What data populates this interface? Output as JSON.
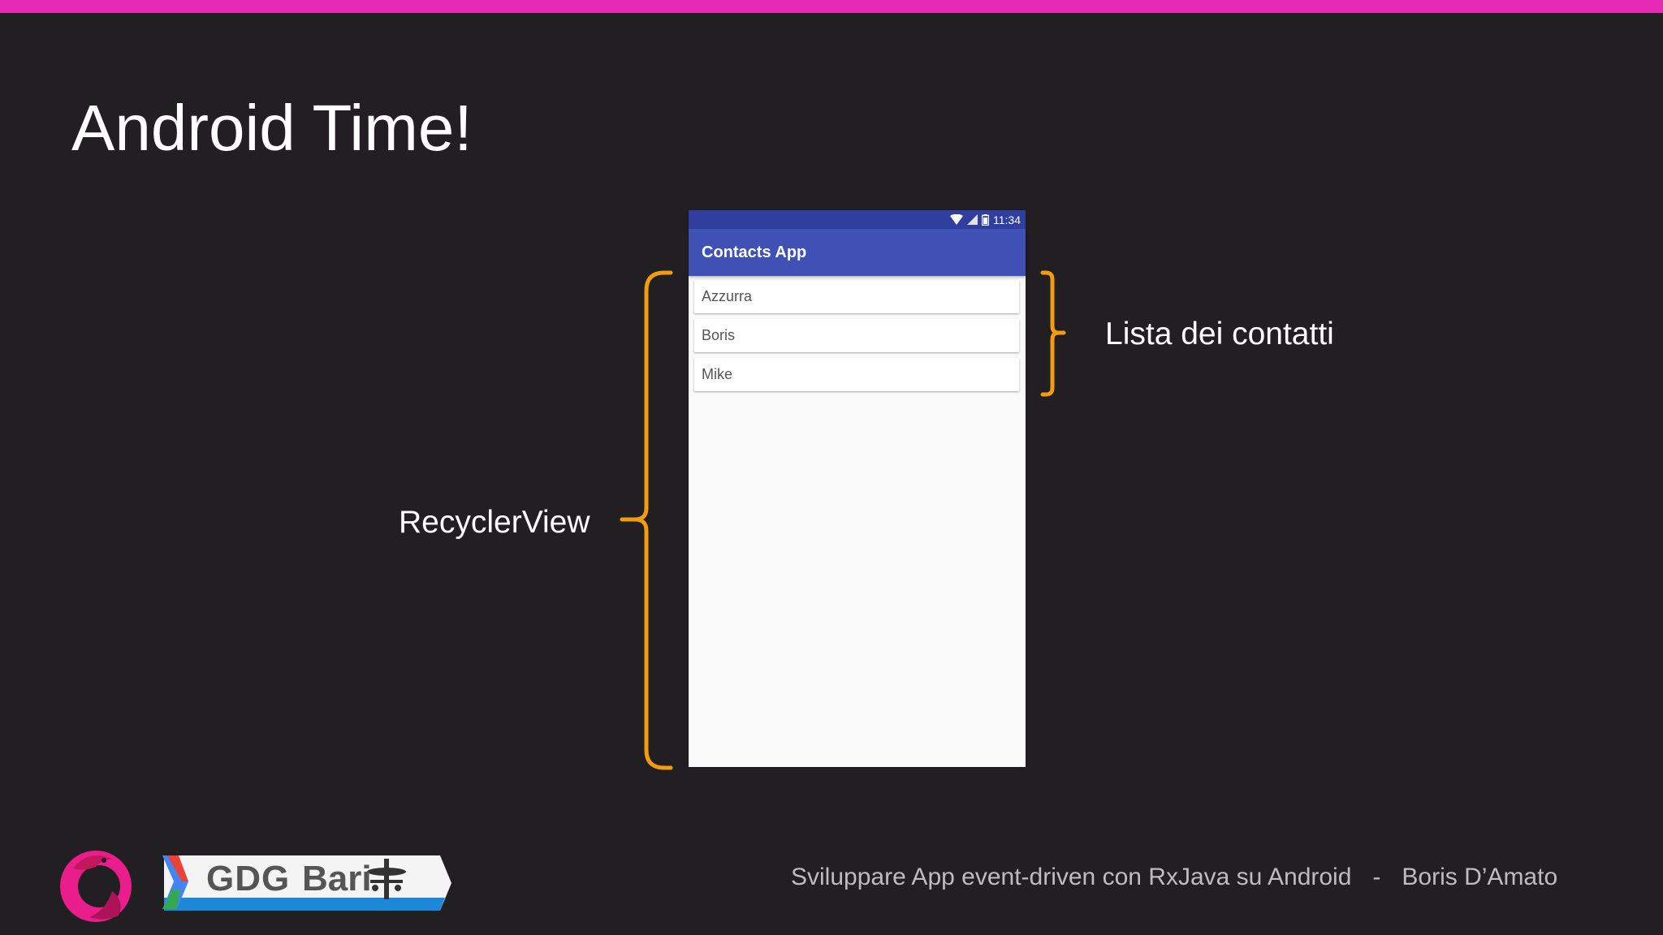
{
  "slide": {
    "title": "Android Time!"
  },
  "phone": {
    "status_time": "11:34",
    "app_title": "Contacts App",
    "contacts": [
      "Azzurra",
      "Boris",
      "Mike"
    ]
  },
  "annotations": {
    "recycler_label": "RecyclerView",
    "list_label": "Lista dei contatti"
  },
  "footer": {
    "gdg_label": "GDG",
    "city_label": "Bari",
    "talk_title": "Sviluppare App event-driven con RxJava su Android",
    "separator": "-",
    "author": "Boris D’Amato"
  },
  "colors": {
    "background": "#211f22",
    "accent_bar": "#e52bb4",
    "brace": "#f39c12",
    "app_bar": "#3f51b5",
    "status_bar": "#303f9f"
  },
  "icons": [
    "wifi-icon",
    "signal-icon",
    "battery-icon",
    "rx-logo-icon",
    "gdg-chevron-icon",
    "bari-petruzzelli-icon"
  ]
}
